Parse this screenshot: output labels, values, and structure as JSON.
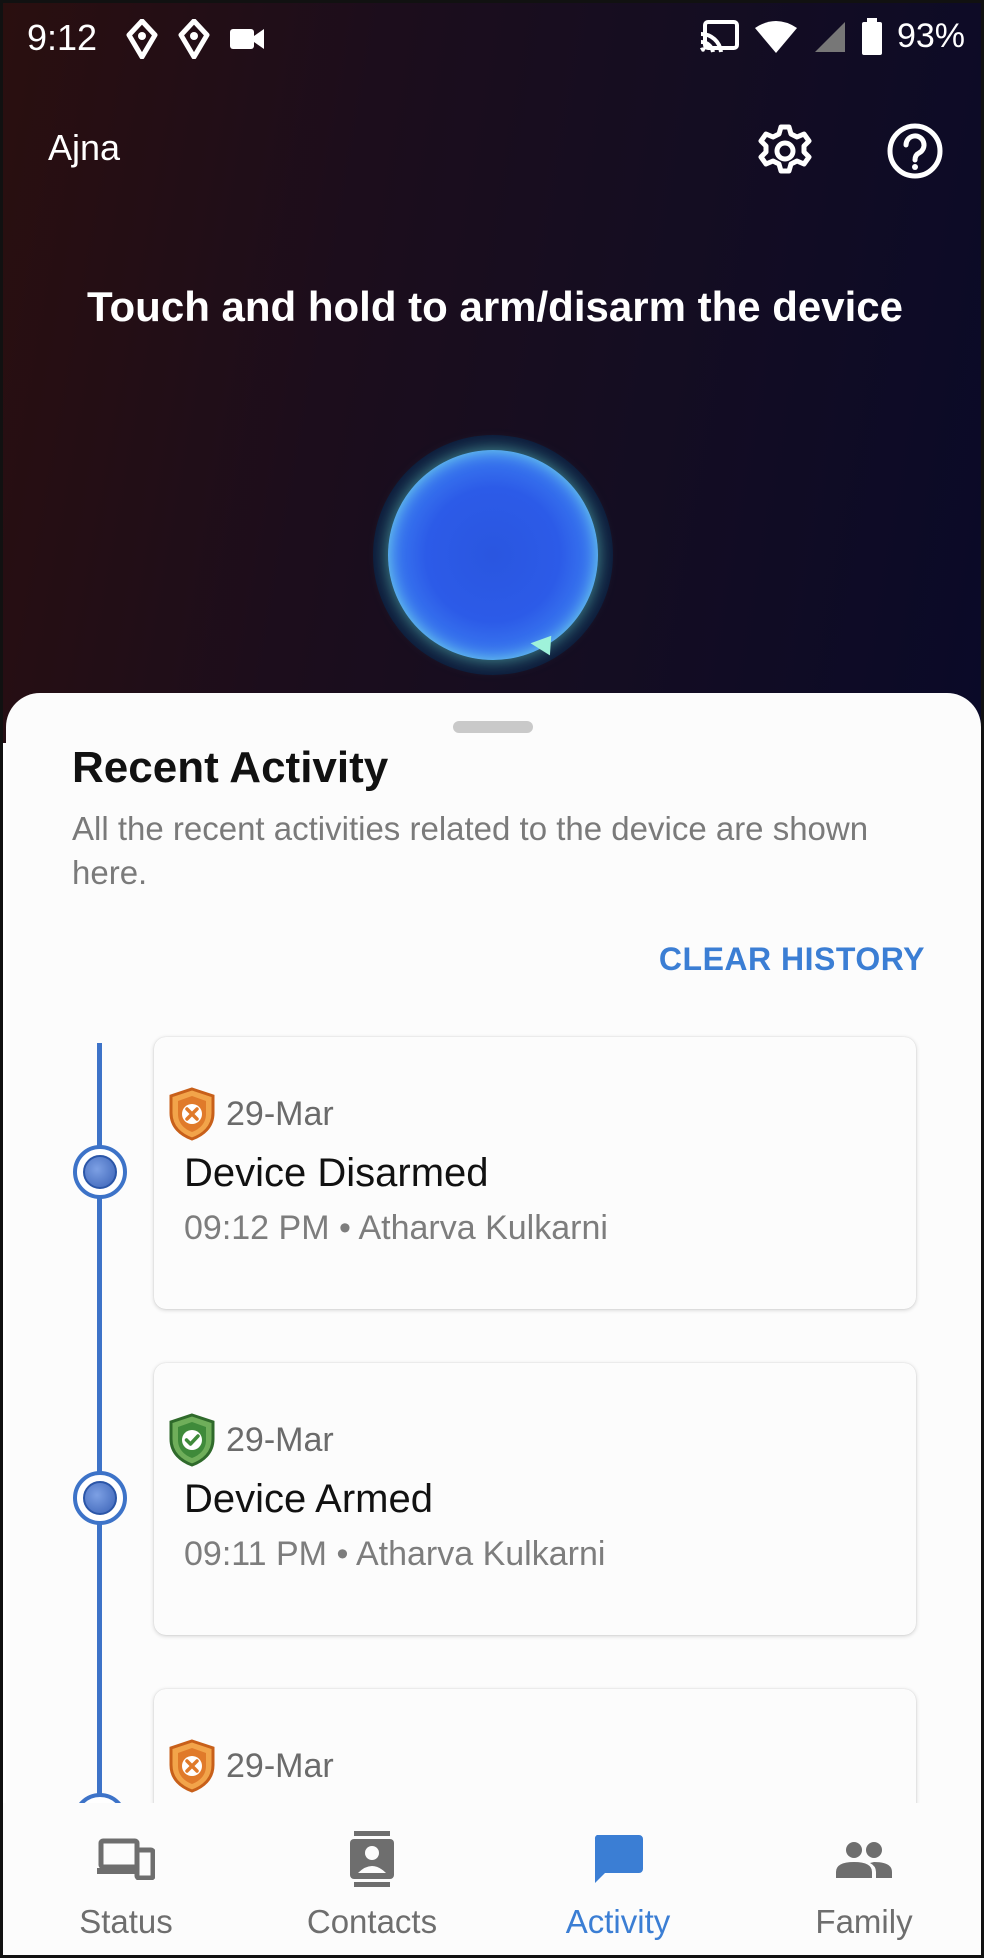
{
  "status_bar": {
    "time": "9:12",
    "battery_percent": "93%"
  },
  "app_bar": {
    "title": "Ajna"
  },
  "hero": {
    "instruction": "Touch and hold to arm/disarm the device"
  },
  "activity_sheet": {
    "title": "Recent Activity",
    "subtitle": "All the recent activities related to the device are shown here.",
    "clear_label": "CLEAR HISTORY",
    "items": [
      {
        "status": "disarmed",
        "icon": "shield-x-icon",
        "date": "29-Mar",
        "title": "Device Disarmed",
        "time": "09:12 PM",
        "user": "Atharva Kulkarni"
      },
      {
        "status": "armed",
        "icon": "shield-check-icon",
        "date": "29-Mar",
        "title": "Device Armed",
        "time": "09:11 PM",
        "user": "Atharva Kulkarni"
      },
      {
        "status": "disarmed",
        "icon": "shield-x-icon",
        "date": "29-Mar",
        "title": "",
        "time": "",
        "user": ""
      }
    ]
  },
  "bottom_nav": {
    "items": [
      {
        "label": "Status",
        "icon": "devices-icon",
        "active": false
      },
      {
        "label": "Contacts",
        "icon": "contacts-icon",
        "active": false
      },
      {
        "label": "Activity",
        "icon": "chat-icon",
        "active": true
      },
      {
        "label": "Family",
        "icon": "people-icon",
        "active": false
      }
    ]
  },
  "colors": {
    "accent": "#3b7ed4",
    "timeline": "#3d73c8",
    "disarmed_shield": "#e07a2a",
    "armed_shield": "#3f8a3a"
  }
}
